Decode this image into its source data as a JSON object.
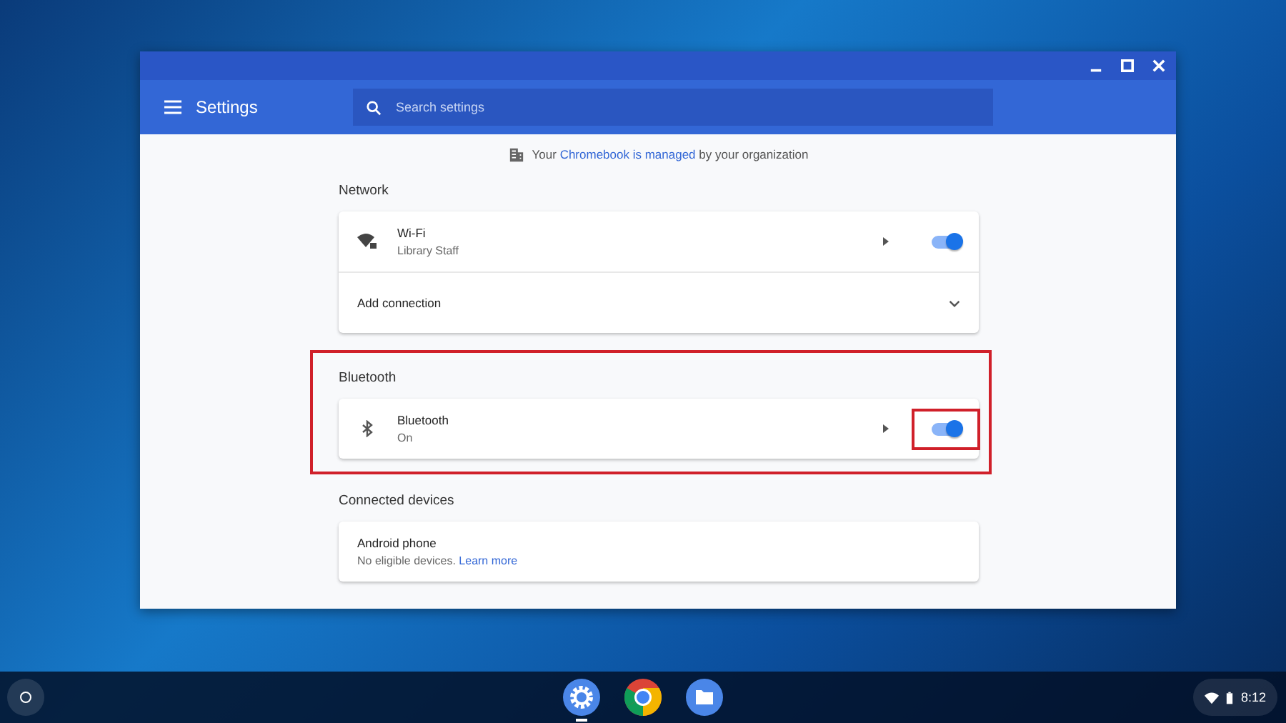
{
  "window": {
    "title": "Settings"
  },
  "search": {
    "placeholder": "Search settings"
  },
  "notice": {
    "prefix": "Your",
    "link": "Chromebook is managed",
    "suffix": "by your organization"
  },
  "sections": [
    {
      "title": "Network",
      "highlighted": false,
      "rows": [
        {
          "kind": "wifi",
          "title": "Wi-Fi",
          "subtitle": "Library Staff",
          "on": true,
          "highlighted": false
        },
        {
          "kind": "expand",
          "title": "Add connection"
        }
      ]
    },
    {
      "title": "Bluetooth",
      "highlighted": true,
      "rows": [
        {
          "kind": "bluetooth",
          "title": "Bluetooth",
          "subtitle": "On",
          "on": true,
          "highlighted": true
        }
      ]
    },
    {
      "title": "Connected devices",
      "highlighted": false,
      "rows": [
        {
          "kind": "info",
          "title": "Android phone",
          "subtitle": "No eligible devices.",
          "link": "Learn more"
        }
      ]
    }
  ],
  "shelf": {
    "apps": [
      {
        "kind": "settings",
        "selected": true
      },
      {
        "kind": "browser",
        "selected": false
      },
      {
        "kind": "files",
        "selected": false
      }
    ],
    "time": "8:12"
  }
}
